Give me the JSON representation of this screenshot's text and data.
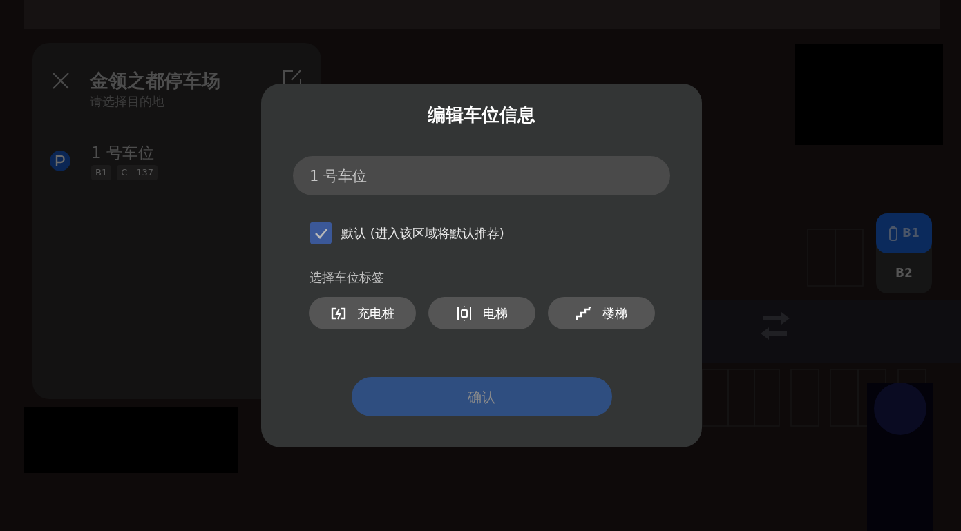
{
  "panel": {
    "title": "金领之都停车场",
    "subtitle": "请选择目的地",
    "spot": {
      "name": "1 号车位",
      "tags": [
        "B1",
        "C - 137"
      ]
    }
  },
  "floors": [
    {
      "label": "B1",
      "selected": true
    },
    {
      "label": "B2",
      "selected": false
    }
  ],
  "dialog": {
    "title": "编辑车位信息",
    "name_field": {
      "value": "1 号车位"
    },
    "default_option": {
      "label": "默认 (进入该区域将默认推荐)",
      "checked": true
    },
    "tags_label": "选择车位标签",
    "tags": [
      {
        "kind": "charger",
        "label": "充电桩",
        "selected": false
      },
      {
        "kind": "elevator",
        "label": "电梯",
        "selected": false
      },
      {
        "kind": "stairs",
        "label": "楼梯",
        "selected": false
      }
    ],
    "confirm": {
      "label": "确认",
      "disabled": true
    }
  }
}
